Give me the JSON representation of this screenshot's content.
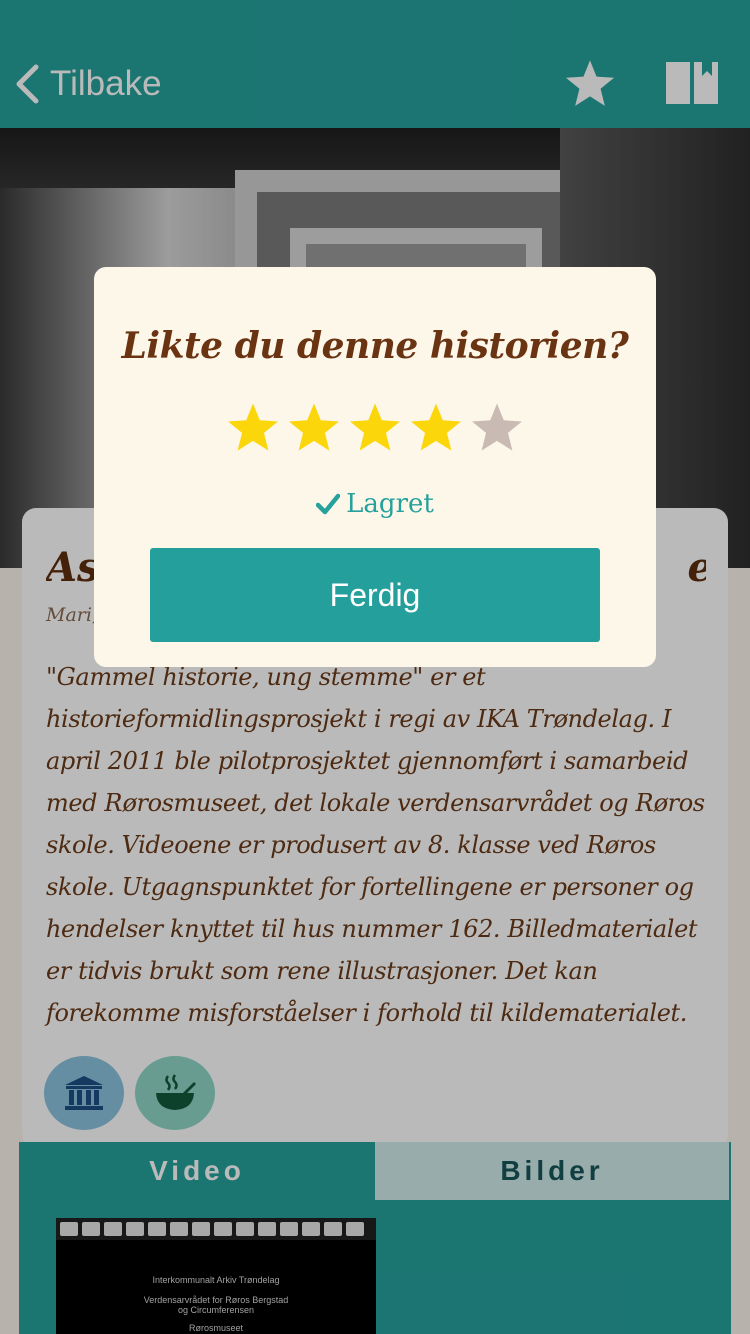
{
  "header": {
    "back_label": "Tilbake",
    "favorite_icon": "star-icon",
    "bookmark_icon": "book-bookmark-icon"
  },
  "story": {
    "title": "Asp",
    "title_end": "e",
    "byline": "Mari,",
    "description": "\"Gammel historie, ung stemme\" er et historieformidlingsprosjekt i regi av IKA Trøndelag. I april 2011 ble pilotprosjektet gjennomført i samarbeid med Rørosmuseet, det lokale verdensarvrådet og Røros skole. Videoene er produsert av 8. klasse ved Røros skole. Utgagnspunktet for fortellingene er personer og hendelser knyttet til hus nummer 162. Billedmaterialet er tidvis brukt som rene illustrasjoner. Det kan forekomme misforståelser i forhold til kildematerialet.",
    "categories": [
      {
        "icon": "museum-icon"
      },
      {
        "icon": "food-bowl-icon"
      }
    ]
  },
  "tabs": [
    {
      "label": "Video",
      "active": true
    },
    {
      "label": "Bilder",
      "active": false
    }
  ],
  "video_thumb": {
    "line1": "Interkommunalt Arkiv Trøndelag",
    "line2": "Verdensarvrådet  for Røros Bergstad",
    "line3": "og Circumferensen",
    "line4": "Rørosmuseet"
  },
  "rating_modal": {
    "title": "Likte du denne historien?",
    "rating": 4,
    "max_rating": 5,
    "saved_label": "Lagret",
    "done_label": "Ferdig"
  },
  "colors": {
    "teal": "#26a19c",
    "star_filled": "#fbd60a",
    "star_empty": "#c9bbb3",
    "title_brown": "#6a3312"
  }
}
